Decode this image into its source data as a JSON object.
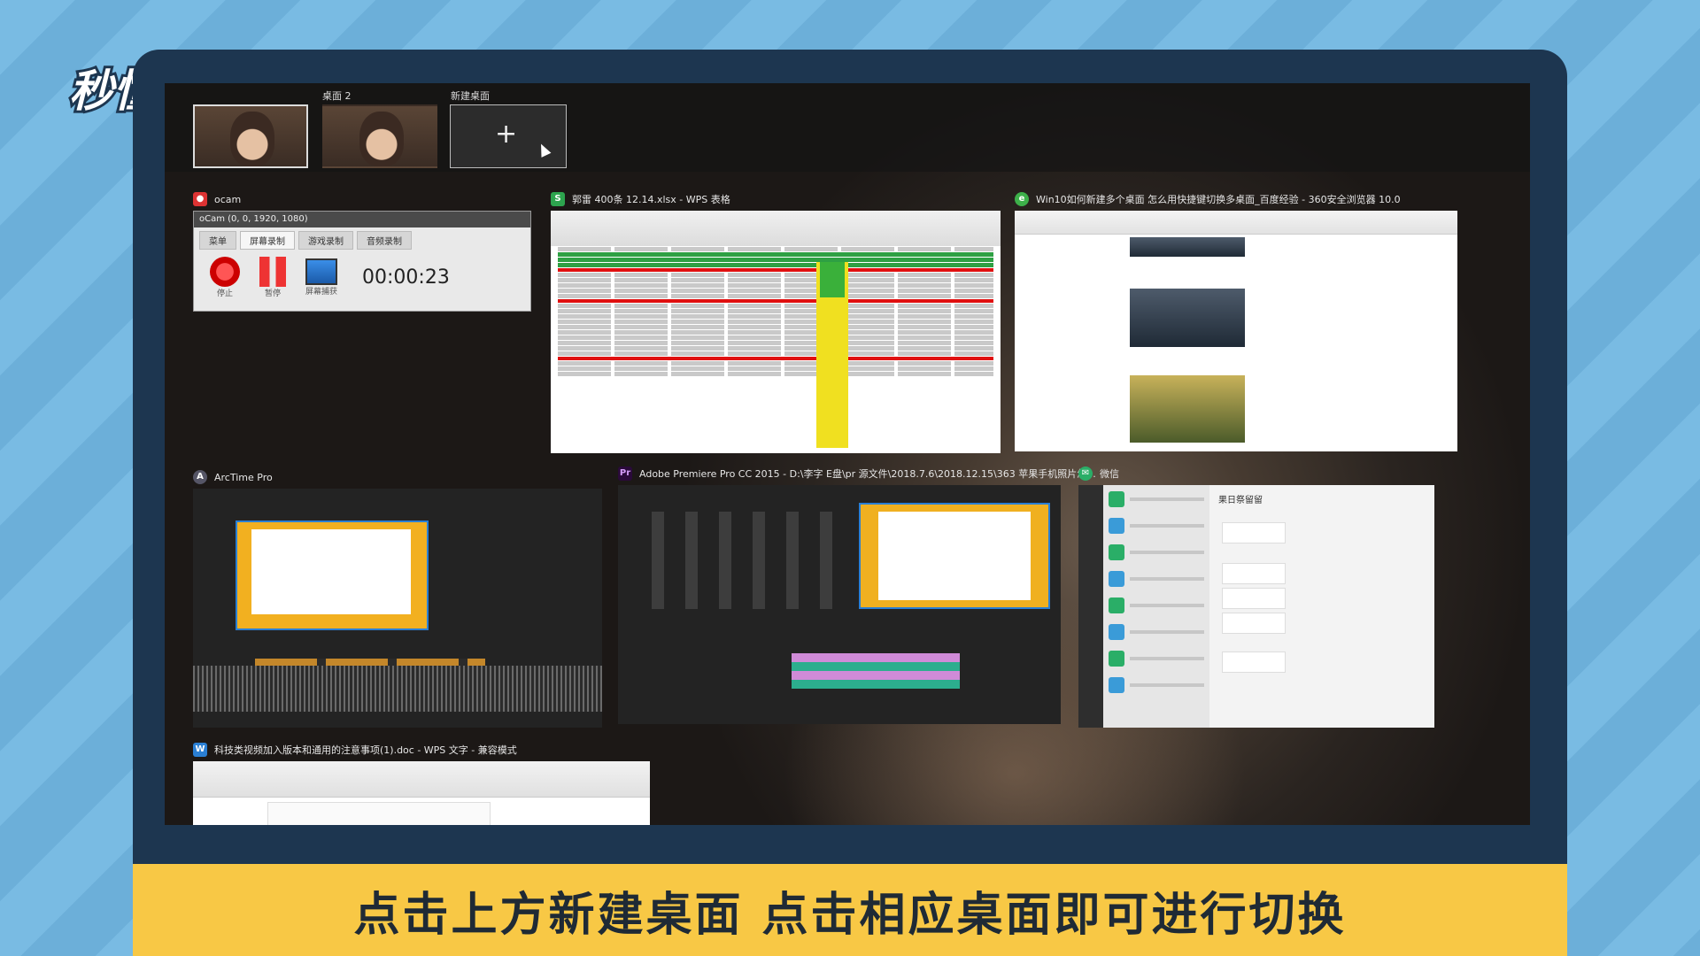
{
  "logo": {
    "text": "秒懂视频"
  },
  "topbar": {
    "desktops": [
      {
        "label": ""
      },
      {
        "label": "桌面 2"
      }
    ],
    "new_desktop_label": "新建桌面",
    "new_desktop_plus": "+"
  },
  "windows": {
    "ocam": {
      "app_name": "ocam",
      "header": "oCam (0, 0, 1920, 1080)",
      "tabs": [
        "菜单",
        "屏幕录制",
        "游戏录制",
        "音频录制"
      ],
      "tools": [
        "停止",
        "暂停",
        "屏幕捕获"
      ],
      "timer": "00:00:23"
    },
    "wps_sheet": {
      "title": "郭雷 400条 12.14.xlsx - WPS 表格"
    },
    "browser": {
      "title": "Win10如何新建多个桌面 怎么用快捷键切换多桌面_百度经验 - 360安全浏览器 10.0"
    },
    "arctime": {
      "title": "ArcTime Pro"
    },
    "premiere": {
      "title": "Adobe Premiere Pro CC 2015 - D:\\李字 E盘\\pr 源文件\\2018.7.6\\2018.12.15\\363 苹果手机照片怎..."
    },
    "wechat": {
      "title": "微信",
      "chat_title": "果日祭留留"
    },
    "wps_doc": {
      "title": "科技类视频加入版本和通用的注意事项(1).doc - WPS 文字 - 兼容模式"
    }
  },
  "caption": {
    "text": "点击上方新建桌面 点击相应桌面即可进行切换"
  },
  "colors": {
    "frame": "#1d3650",
    "caption_bg": "#f8c845",
    "background": "#6fb3dd"
  }
}
